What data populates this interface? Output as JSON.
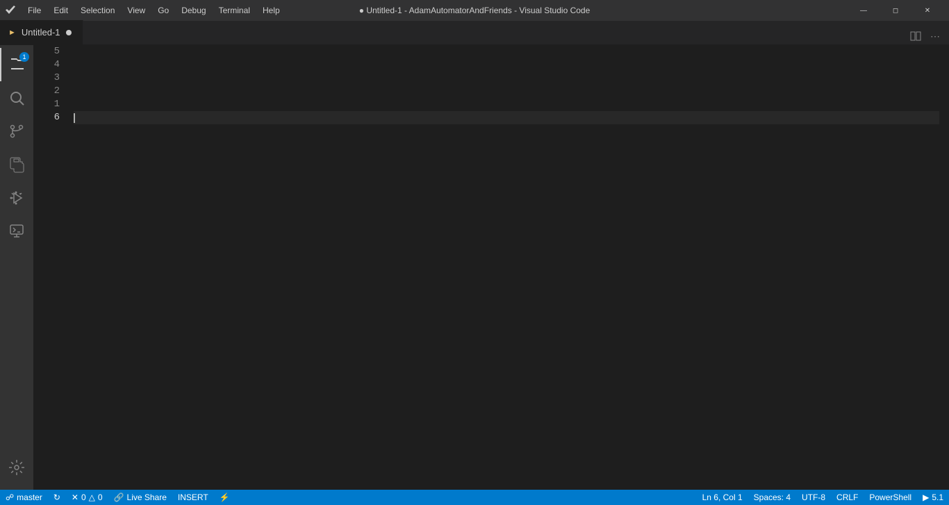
{
  "titlebar": {
    "title": "● Untitled-1 - AdamAutomatorAndFriends - Visual Studio Code",
    "menu": [
      "File",
      "Edit",
      "Selection",
      "View",
      "Go",
      "Debug",
      "Terminal",
      "Help"
    ],
    "buttons": [
      "—",
      "❐",
      "✕"
    ]
  },
  "tab": {
    "icon": "▷",
    "label": "Untitled-1",
    "modified": true
  },
  "editor": {
    "line_numbers": [
      "5",
      "4",
      "3",
      "2",
      "1",
      "6"
    ],
    "active_line": 6
  },
  "activity": {
    "items": [
      {
        "name": "explorer",
        "badge": "1"
      },
      {
        "name": "search"
      },
      {
        "name": "source-control"
      },
      {
        "name": "extensions"
      },
      {
        "name": "run-debug"
      },
      {
        "name": "remote-explorer"
      }
    ],
    "bottom": [
      {
        "name": "settings"
      }
    ]
  },
  "statusbar": {
    "branch": "master",
    "sync_icon": "↻",
    "errors": "0",
    "warnings": "0",
    "live_share": "Live Share",
    "mode": "INSERT",
    "feedback": "⚡",
    "ln_col": "Ln 6, Col 1",
    "spaces": "Spaces: 4",
    "encoding": "UTF-8",
    "line_ending": "CRLF",
    "language": "PowerShell",
    "powershell_version": "5.1"
  }
}
